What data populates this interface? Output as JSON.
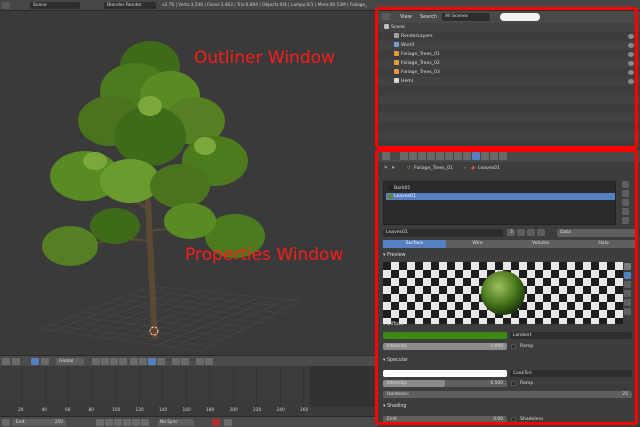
{
  "topbar": {
    "scene": "Scene",
    "engine": "Blender Render",
    "stats": "v2.76 | Verts:3,546 | Faces:3,463 | Tris:6,894 | Objects:0/4 | Lamps:0/1 | Mem:40.53M | Foliage_"
  },
  "viewport": {
    "mode": "Global"
  },
  "timeline": {
    "ticks": [
      "20",
      "40",
      "60",
      "80",
      "100",
      "120",
      "140",
      "160",
      "180",
      "200",
      "220",
      "240",
      "260"
    ]
  },
  "playbar": {
    "start_label": "Start: 1",
    "end_label": "End:",
    "end_value": "250",
    "sync": "No Sync"
  },
  "outliner": {
    "menu": [
      "View",
      "Search"
    ],
    "scenes_select": "All Scenes",
    "rows": [
      {
        "label": "Scene",
        "indent": 0,
        "color": "#bdbdbd"
      },
      {
        "label": "RenderLayers",
        "indent": 1,
        "color": "#9f9f9f"
      },
      {
        "label": "World",
        "indent": 1,
        "color": "#6fa0d8"
      },
      {
        "label": "Foliage_Trees_01",
        "indent": 1,
        "color": "#e69a3a"
      },
      {
        "label": "Foliage_Trees_02",
        "indent": 1,
        "color": "#e69a3a"
      },
      {
        "label": "Foliage_Trees_03",
        "indent": 1,
        "color": "#e69a3a"
      },
      {
        "label": "Hemi",
        "indent": 1,
        "color": "#d8d8d8"
      }
    ]
  },
  "properties": {
    "path_object": "Foliage_Trees_01",
    "path_material": "Leaves01",
    "slots": [
      {
        "label": "Bark01",
        "color": "#222",
        "selected": false
      },
      {
        "label": "Leaves01",
        "color": "#5d8a2a",
        "selected": true
      }
    ],
    "material_name": "Leaves01",
    "users": "3",
    "data_select": "Data",
    "tabs": [
      "Surface",
      "Wire",
      "Volume",
      "Halo"
    ],
    "panels": {
      "preview": "Preview",
      "diffuse": "Diffuse",
      "specular": "Specular",
      "shading": "Shading"
    },
    "diffuse": {
      "color": "#3f8a12",
      "shader": "Lambert",
      "intensity_label": "Intensity:",
      "intensity_value": "1.000",
      "intensity": 1.0,
      "ramp": "Ramp"
    },
    "specular": {
      "color": "#ffffff",
      "shader": "CookTorr",
      "intensity_label": "Intensity:",
      "intensity_value": "0.500",
      "intensity": 0.5,
      "ramp": "Ramp",
      "hardness_label": "Hardness:",
      "hardness_value": "25"
    },
    "shading": {
      "emit_label": "Emit",
      "emit_value": "0.00",
      "shadeless": "Shadeless"
    }
  },
  "annotations": {
    "outliner": "Outliner Window",
    "properties": "Properties Window"
  },
  "colors": {
    "accent": "#5680c2",
    "annotation": "#ff0000",
    "leaf": "#4e7a1e"
  }
}
